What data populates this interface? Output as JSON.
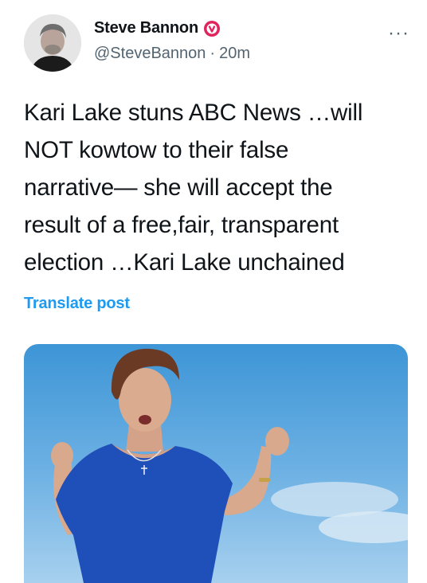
{
  "tweet": {
    "display_name": "Steve Bannon",
    "verified_badge": "v-badge-icon",
    "handle": "@SteveBannon",
    "separator": "·",
    "time": "20m",
    "more_icon": "more-icon",
    "text": "Kari Lake stuns ABC News …will\nNOT kowtow to their false\nnarrative— she will accept the\nresult of a free,fair, transparent\nelection …Kari Lake unchained",
    "translate_label": "Translate post"
  },
  "colors": {
    "badge": "#e0245e",
    "link": "#1d9bf0",
    "secondary_text": "#536471"
  }
}
